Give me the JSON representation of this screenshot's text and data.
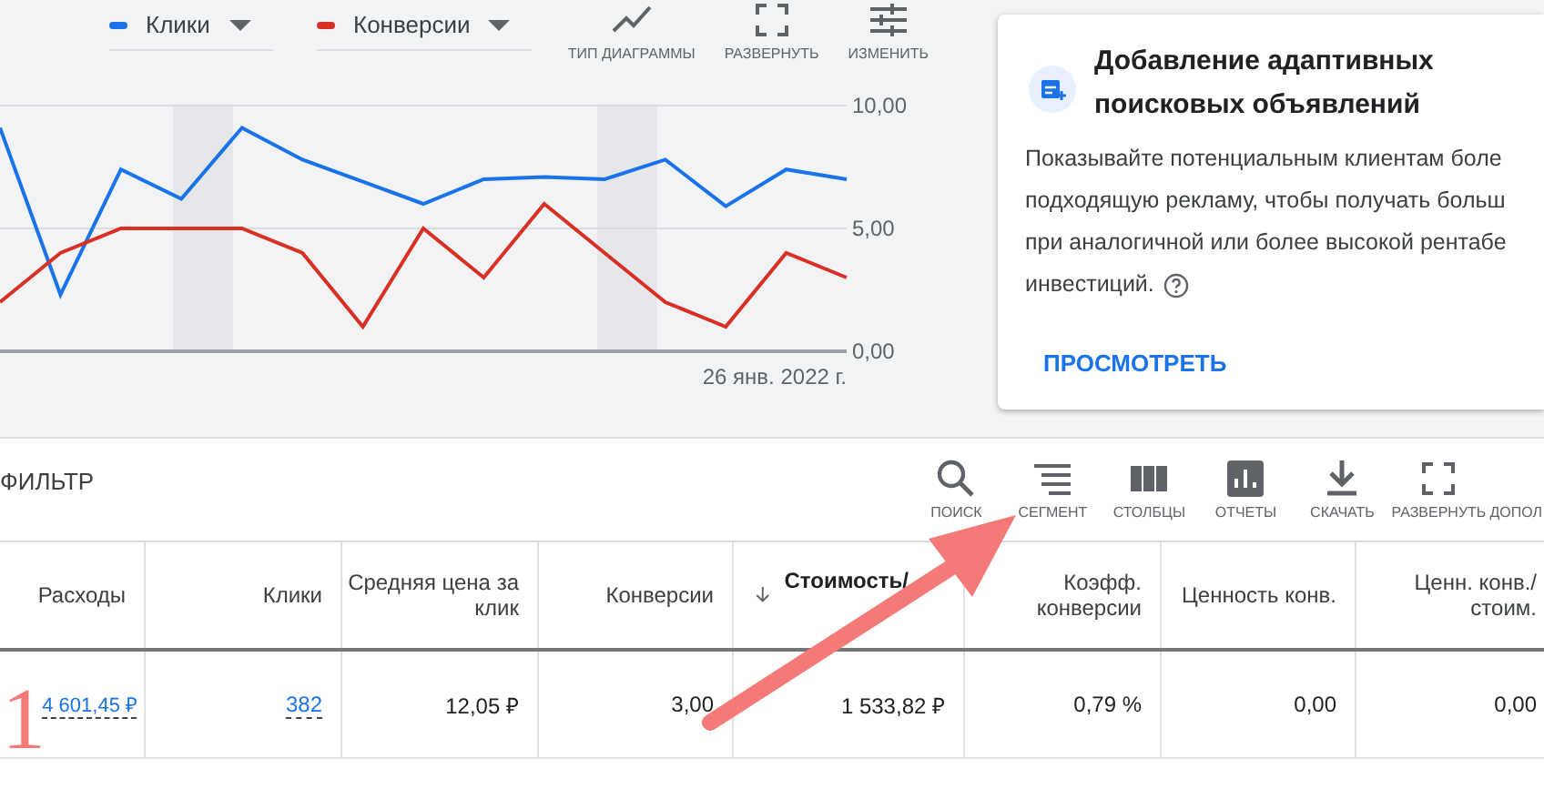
{
  "chart_panel": {
    "tools": [
      {
        "kind": "line",
        "label": "ТИП ДИАГРАММЫ"
      },
      {
        "kind": "expand",
        "label": "РАЗВЕРНУТЬ"
      },
      {
        "kind": "tune",
        "label": "ИЗМЕНИТЬ"
      }
    ],
    "chart_data": {
      "type": "line",
      "series": [
        {
          "name": "Клики",
          "color": "#1a73e8",
          "values": [
            9.1,
            2.3,
            7.4,
            6.2,
            9.1,
            7.8,
            6.9,
            6.0,
            7.0,
            7.1,
            7.0,
            7.8,
            5.9,
            7.4,
            7.0
          ]
        },
        {
          "name": "Конверсии",
          "color": "#d93025",
          "values": [
            2,
            4,
            5,
            5,
            5,
            4,
            1,
            5,
            3,
            6,
            4,
            2,
            1,
            4,
            3
          ]
        }
      ],
      "ylim": [
        0,
        10
      ],
      "yticks": [
        {
          "value": 0,
          "label": "0,00"
        },
        {
          "value": 5,
          "label": "5,00"
        },
        {
          "value": 10,
          "label": "10,00"
        }
      ]
    },
    "date_label": "26 янв. 2022 г."
  },
  "recommendation": {
    "title": "Добавление адаптивных поисковых объявлений",
    "lines": [
      "Показывайте потенциальным клиентам боле",
      "подходящую рекламу, чтобы получать больш",
      "при аналогичной или более высокой рентабе",
      "инвестиций."
    ],
    "action": "ПРОСМОТРЕТЬ"
  },
  "toolbar": {
    "filter": "ФИЛЬТР",
    "tools": [
      {
        "kind": "search",
        "label": "ПОИСК"
      },
      {
        "kind": "segment",
        "label": "СЕГМЕНТ"
      },
      {
        "kind": "columns",
        "label": "СТОЛБЦЫ"
      },
      {
        "kind": "reports",
        "label": "ОТЧЕТЫ"
      },
      {
        "kind": "download",
        "label": "СКАЧАТЬ"
      },
      {
        "kind": "expand",
        "label": "РАЗВЕРНУТЬ"
      },
      {
        "kind": "none",
        "label": "ДОПОЛ"
      }
    ]
  },
  "table": {
    "columns": [
      {
        "label": "Расходы",
        "sorted": false
      },
      {
        "label": "Клики",
        "sorted": false
      },
      {
        "label": "Средняя цена за клик",
        "sorted": false
      },
      {
        "label": "Конверсии",
        "sorted": false
      },
      {
        "label": "Стоимость/",
        "sorted": true
      },
      {
        "label": "Коэфф. конверсии",
        "sorted": false
      },
      {
        "label": "Ценность конв.",
        "sorted": false
      },
      {
        "label": "Ценн. конв./ стоим.",
        "sorted": false
      }
    ],
    "rows": [
      {
        "cells": [
          {
            "text": "4 601,45 ₽",
            "link": true
          },
          {
            "text": "382",
            "link": true
          },
          {
            "text": "12,05 ₽",
            "link": false
          },
          {
            "text": "3,00",
            "link": false
          },
          {
            "text": "1 533,82 ₽",
            "link": false
          },
          {
            "text": "0,79 %",
            "link": false
          },
          {
            "text": "0,00",
            "link": false
          },
          {
            "text": "0,00",
            "link": false
          }
        ]
      }
    ]
  },
  "annotation": {
    "number": "1"
  }
}
